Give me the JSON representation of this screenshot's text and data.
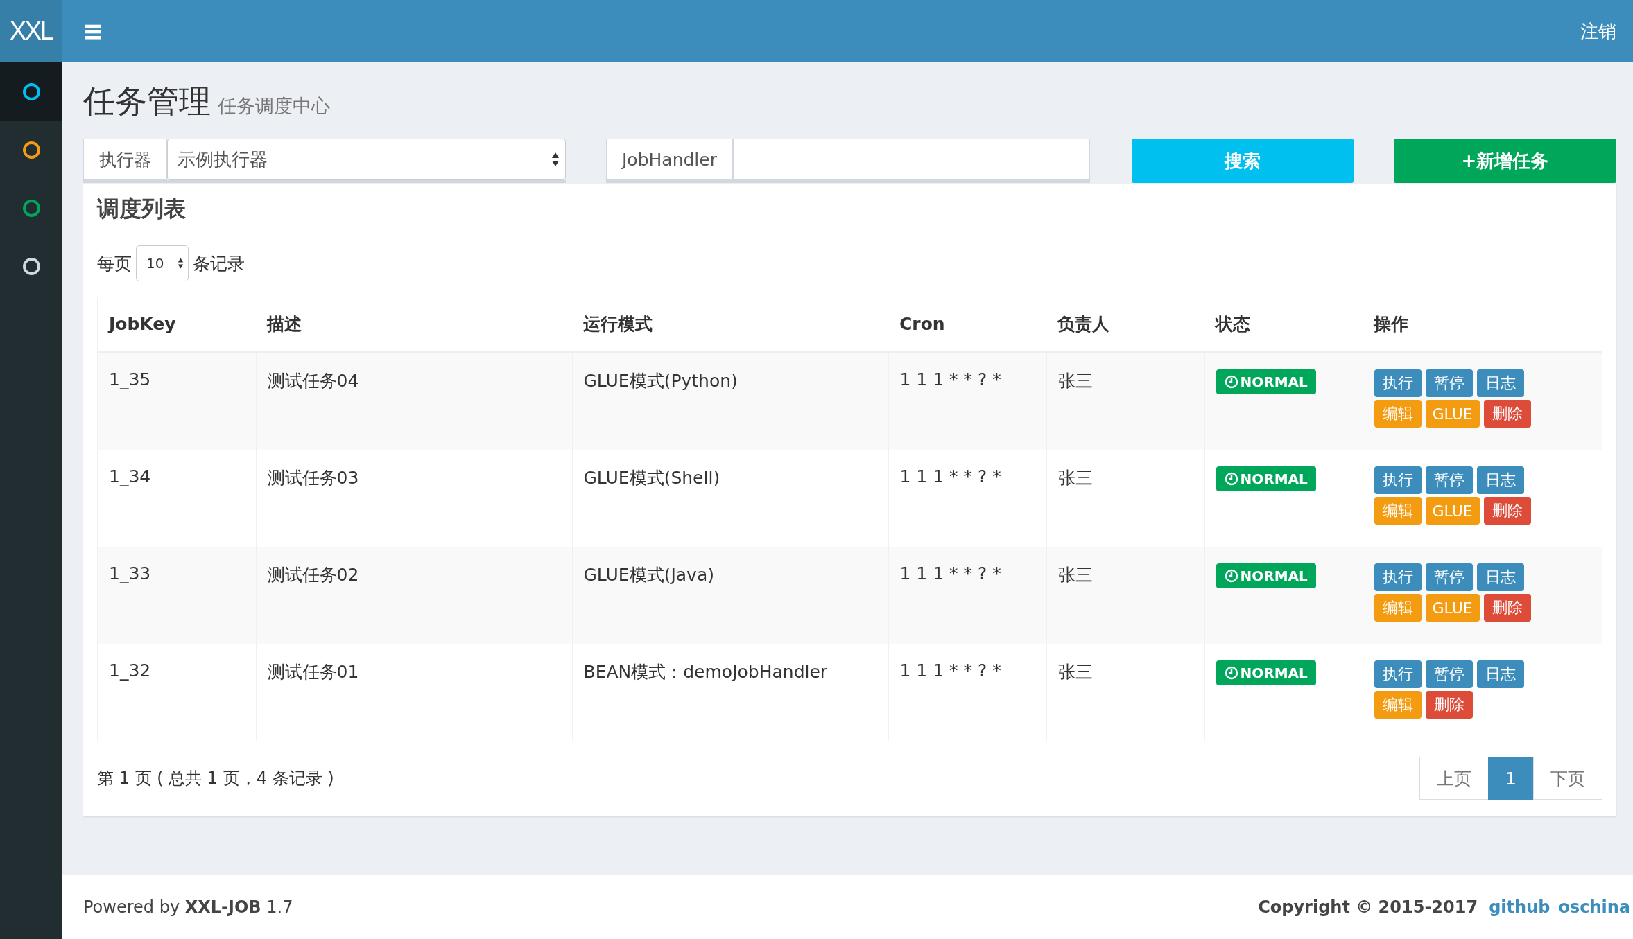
{
  "header": {
    "logo": "XXL",
    "menu_icon": "≡",
    "logout": "注销"
  },
  "sidebar": {
    "items": [
      {
        "color": "#00c0ef",
        "selected": true
      },
      {
        "color": "#f39c12",
        "selected": false
      },
      {
        "color": "#00a65a",
        "selected": false
      },
      {
        "color": "#d2d6de",
        "selected": false
      }
    ]
  },
  "page": {
    "title": "任务管理",
    "subtitle": "任务调度中心"
  },
  "filters": {
    "executor_label": "执行器",
    "executor_value": "示例执行器",
    "handler_label": "JobHandler",
    "search_button": "搜索",
    "add_button": "+新增任务"
  },
  "list": {
    "title": "调度列表",
    "per_page_prefix": "每页",
    "per_page_value": "10",
    "per_page_suffix": "条记录",
    "columns": [
      "JobKey",
      "描述",
      "运行模式",
      "Cron",
      "负责人",
      "状态",
      "操作"
    ],
    "rows": [
      {
        "key": "1_35",
        "desc": "测试任务04",
        "mode": "GLUE模式(Python)",
        "cron": "1 1 1 * * ? *",
        "owner": "张三",
        "status": "NORMAL",
        "actions": [
          {
            "label": "执行",
            "kind": "primary"
          },
          {
            "label": "暂停",
            "kind": "primary"
          },
          {
            "label": "日志",
            "kind": "primary"
          },
          {
            "label": "编辑",
            "kind": "warning"
          },
          {
            "label": "GLUE",
            "kind": "warning"
          },
          {
            "label": "删除",
            "kind": "danger"
          }
        ]
      },
      {
        "key": "1_34",
        "desc": "测试任务03",
        "mode": "GLUE模式(Shell)",
        "cron": "1 1 1 * * ? *",
        "owner": "张三",
        "status": "NORMAL",
        "actions": [
          {
            "label": "执行",
            "kind": "primary"
          },
          {
            "label": "暂停",
            "kind": "primary"
          },
          {
            "label": "日志",
            "kind": "primary"
          },
          {
            "label": "编辑",
            "kind": "warning"
          },
          {
            "label": "GLUE",
            "kind": "warning"
          },
          {
            "label": "删除",
            "kind": "danger"
          }
        ]
      },
      {
        "key": "1_33",
        "desc": "测试任务02",
        "mode": "GLUE模式(Java)",
        "cron": "1 1 1 * * ? *",
        "owner": "张三",
        "status": "NORMAL",
        "actions": [
          {
            "label": "执行",
            "kind": "primary"
          },
          {
            "label": "暂停",
            "kind": "primary"
          },
          {
            "label": "日志",
            "kind": "primary"
          },
          {
            "label": "编辑",
            "kind": "warning"
          },
          {
            "label": "GLUE",
            "kind": "warning"
          },
          {
            "label": "删除",
            "kind": "danger"
          }
        ]
      },
      {
        "key": "1_32",
        "desc": "测试任务01",
        "mode": "BEAN模式：demoJobHandler",
        "cron": "1 1 1 * * ? *",
        "owner": "张三",
        "status": "NORMAL",
        "actions": [
          {
            "label": "执行",
            "kind": "primary"
          },
          {
            "label": "暂停",
            "kind": "primary"
          },
          {
            "label": "日志",
            "kind": "primary"
          },
          {
            "label": "编辑",
            "kind": "warning"
          },
          {
            "label": "删除",
            "kind": "danger"
          }
        ]
      }
    ],
    "summary": "第 1 页 ( 总共 1 页，4 条记录 )",
    "pagination": [
      {
        "label": "上页",
        "selected": false
      },
      {
        "label": "1",
        "selected": true
      },
      {
        "label": "下页",
        "selected": false
      }
    ]
  },
  "footer": {
    "powered": "Powered by **XXL-JOB** 1.7",
    "copyright": "Copyright © 2015-2017",
    "links": [
      "github",
      "oschina"
    ]
  }
}
